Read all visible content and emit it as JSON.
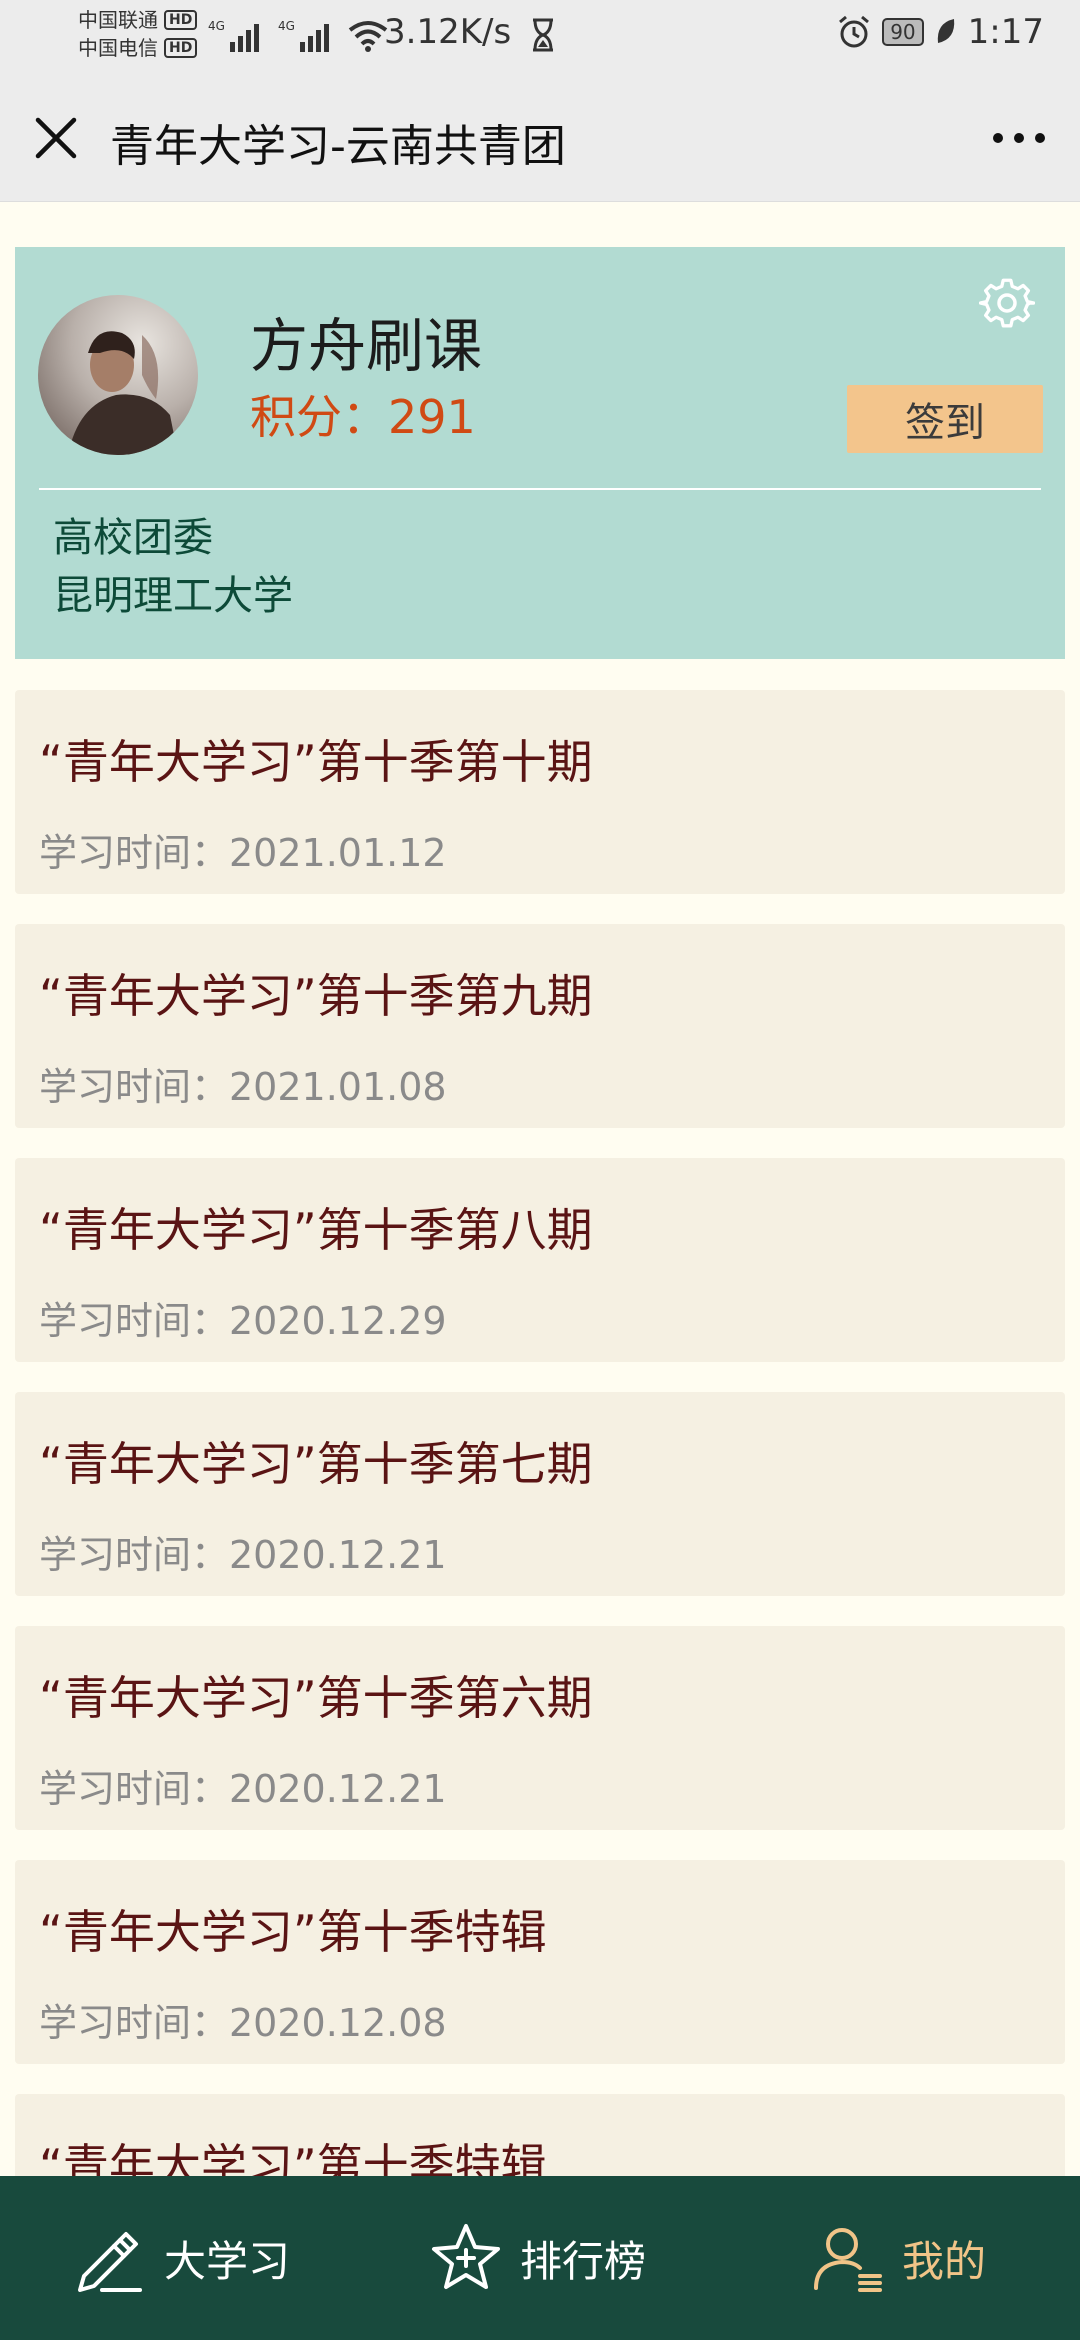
{
  "status_bar": {
    "carrier1": "中国联通",
    "carrier2": "中国电信",
    "hd": "HD",
    "network_label": "4G",
    "net_speed": "3.12K/s",
    "battery": "90",
    "time": "1:17"
  },
  "header": {
    "title": "青年大学习-云南共青团"
  },
  "profile": {
    "name": "方舟刷课",
    "score_label": "积分：",
    "score": "291",
    "signin_label": "签到",
    "org_type": "高校团委",
    "org_name": "昆明理工大学"
  },
  "courses": [
    {
      "title": "“青年大学习”第十季第十期",
      "date": "学习时间：2021.01.12"
    },
    {
      "title": "“青年大学习”第十季第九期",
      "date": "学习时间：2021.01.08"
    },
    {
      "title": "“青年大学习”第十季第八期",
      "date": "学习时间：2020.12.29"
    },
    {
      "title": "“青年大学习”第十季第七期",
      "date": "学习时间：2020.12.21"
    },
    {
      "title": "“青年大学习”第十季第六期",
      "date": "学习时间：2020.12.21"
    },
    {
      "title": "“青年大学习”第十季特辑",
      "date": "学习时间：2020.12.08"
    },
    {
      "title": "“青年大学习”第十季特辑",
      "date": ""
    }
  ],
  "nav": {
    "study": "大学习",
    "rank": "排行榜",
    "mine": "我的"
  },
  "colors": {
    "accent_card": "#b2dbd2",
    "score": "#d04a14",
    "signin_button": "#f3c58c",
    "nav_bg": "#184a3d",
    "nav_active": "#f1c488",
    "course_title": "#5a1414"
  },
  "icons": {
    "close": "close-icon",
    "more": "more-icon",
    "settings": "gear-icon",
    "study": "pencil-icon",
    "rank": "star-icon",
    "mine": "user-icon"
  }
}
